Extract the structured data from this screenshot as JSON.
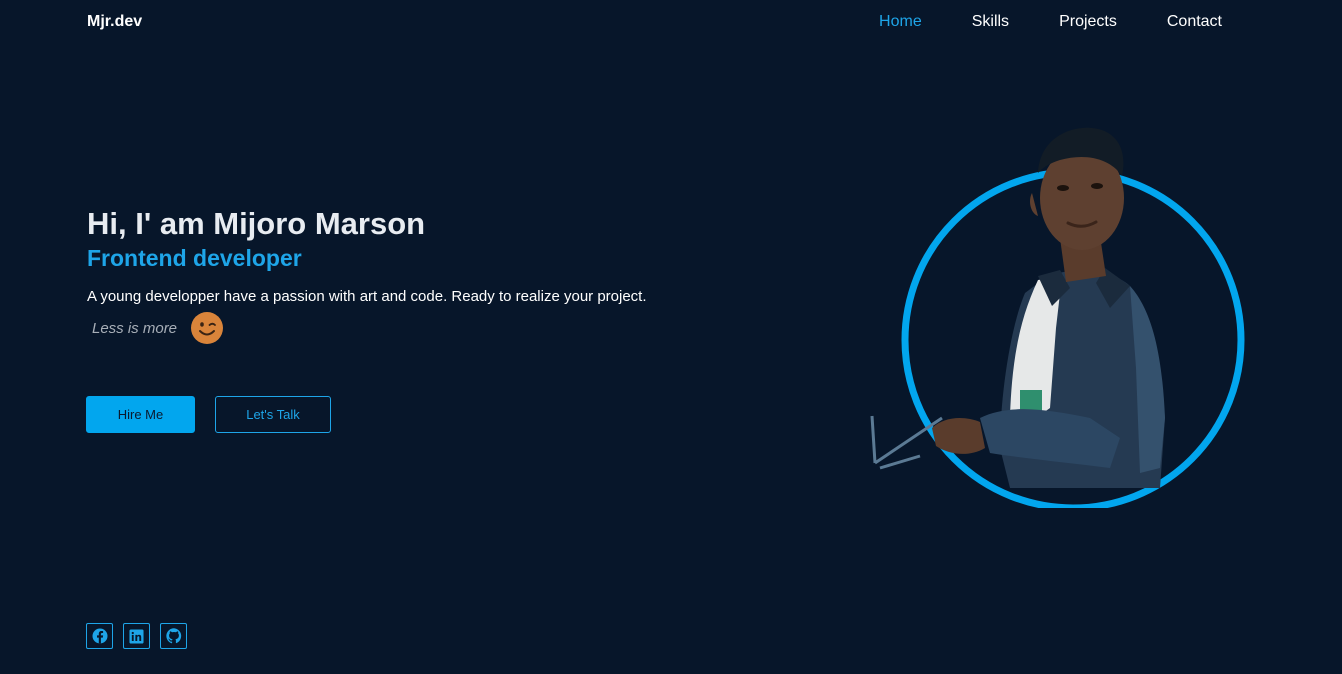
{
  "nav": {
    "brand": "Mjr.dev",
    "links": [
      "Home",
      "Skills",
      "Projects",
      "Contact"
    ],
    "active": "Home"
  },
  "hero": {
    "greeting": "Hi, I' am Mijoro Marson",
    "role": "Frontend developer",
    "description": "A young developper have a passion with art and code. Ready to realize your project.",
    "motto": "Less is more",
    "hire_label": "Hire Me",
    "talk_label": "Let's Talk"
  },
  "social": [
    "facebook-icon",
    "linkedin-icon",
    "github-icon"
  ],
  "colors": {
    "background": "#07162a",
    "accent": "#1ea5e8",
    "button": "#02a6ee",
    "emoji": "#d9843a"
  }
}
